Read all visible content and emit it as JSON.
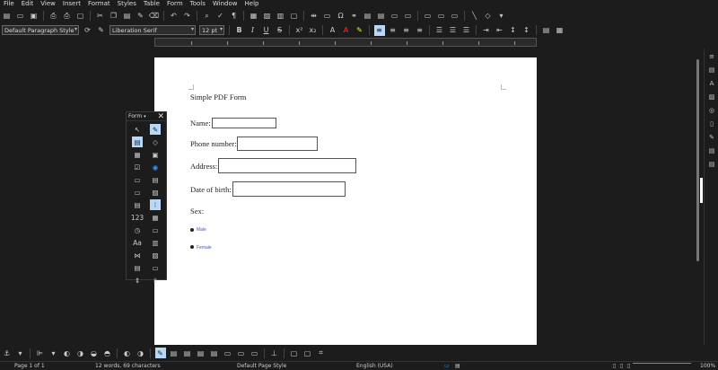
{
  "menu": [
    "File",
    "Edit",
    "View",
    "Insert",
    "Format",
    "Styles",
    "Table",
    "Form",
    "Tools",
    "Window",
    "Help"
  ],
  "toolbar2": {
    "paragraph_style": "Default Paragraph Style",
    "font_name": "Liberation Serif",
    "font_size": "12 pt"
  },
  "document": {
    "title": "Simple PDF Form",
    "fields": [
      {
        "label": "Name:"
      },
      {
        "label": "Phone number:"
      },
      {
        "label": "Address:"
      },
      {
        "label": "Date of birth:"
      }
    ],
    "sex_label": "Sex:",
    "radio_options": [
      "Male",
      "Female"
    ]
  },
  "form_toolbar": {
    "title": "Form",
    "tools": [
      "select-icon",
      "design-mode-icon",
      "control-wizard-icon",
      "form-design-icon",
      "tab-order-icon",
      "form-navigator-icon",
      "checkbox-icon",
      "option-button-icon",
      "text-box-icon",
      "list-box-icon",
      "push-button-icon",
      "image-button-icon",
      "combo-box-icon",
      "formatted-field-icon",
      "numerical-field-icon",
      "date-field-icon",
      "time-field-icon",
      "pattern-field-icon",
      "label-icon",
      "table-control-icon",
      "group-box-icon",
      "image-control-icon",
      "file-selection-icon",
      "navigation-bar-icon",
      "spin-button-icon",
      "scrollbar-icon"
    ]
  },
  "status": {
    "page": "Page 1 of 1",
    "words": "12 words, 69 characters",
    "page_style": "Default Page Style",
    "language": "English (USA)",
    "zoom": "100%"
  },
  "colors": {
    "background": "#1c1c1c",
    "active_button": "#b9d8f5",
    "radio_label": "#4a56a8"
  }
}
